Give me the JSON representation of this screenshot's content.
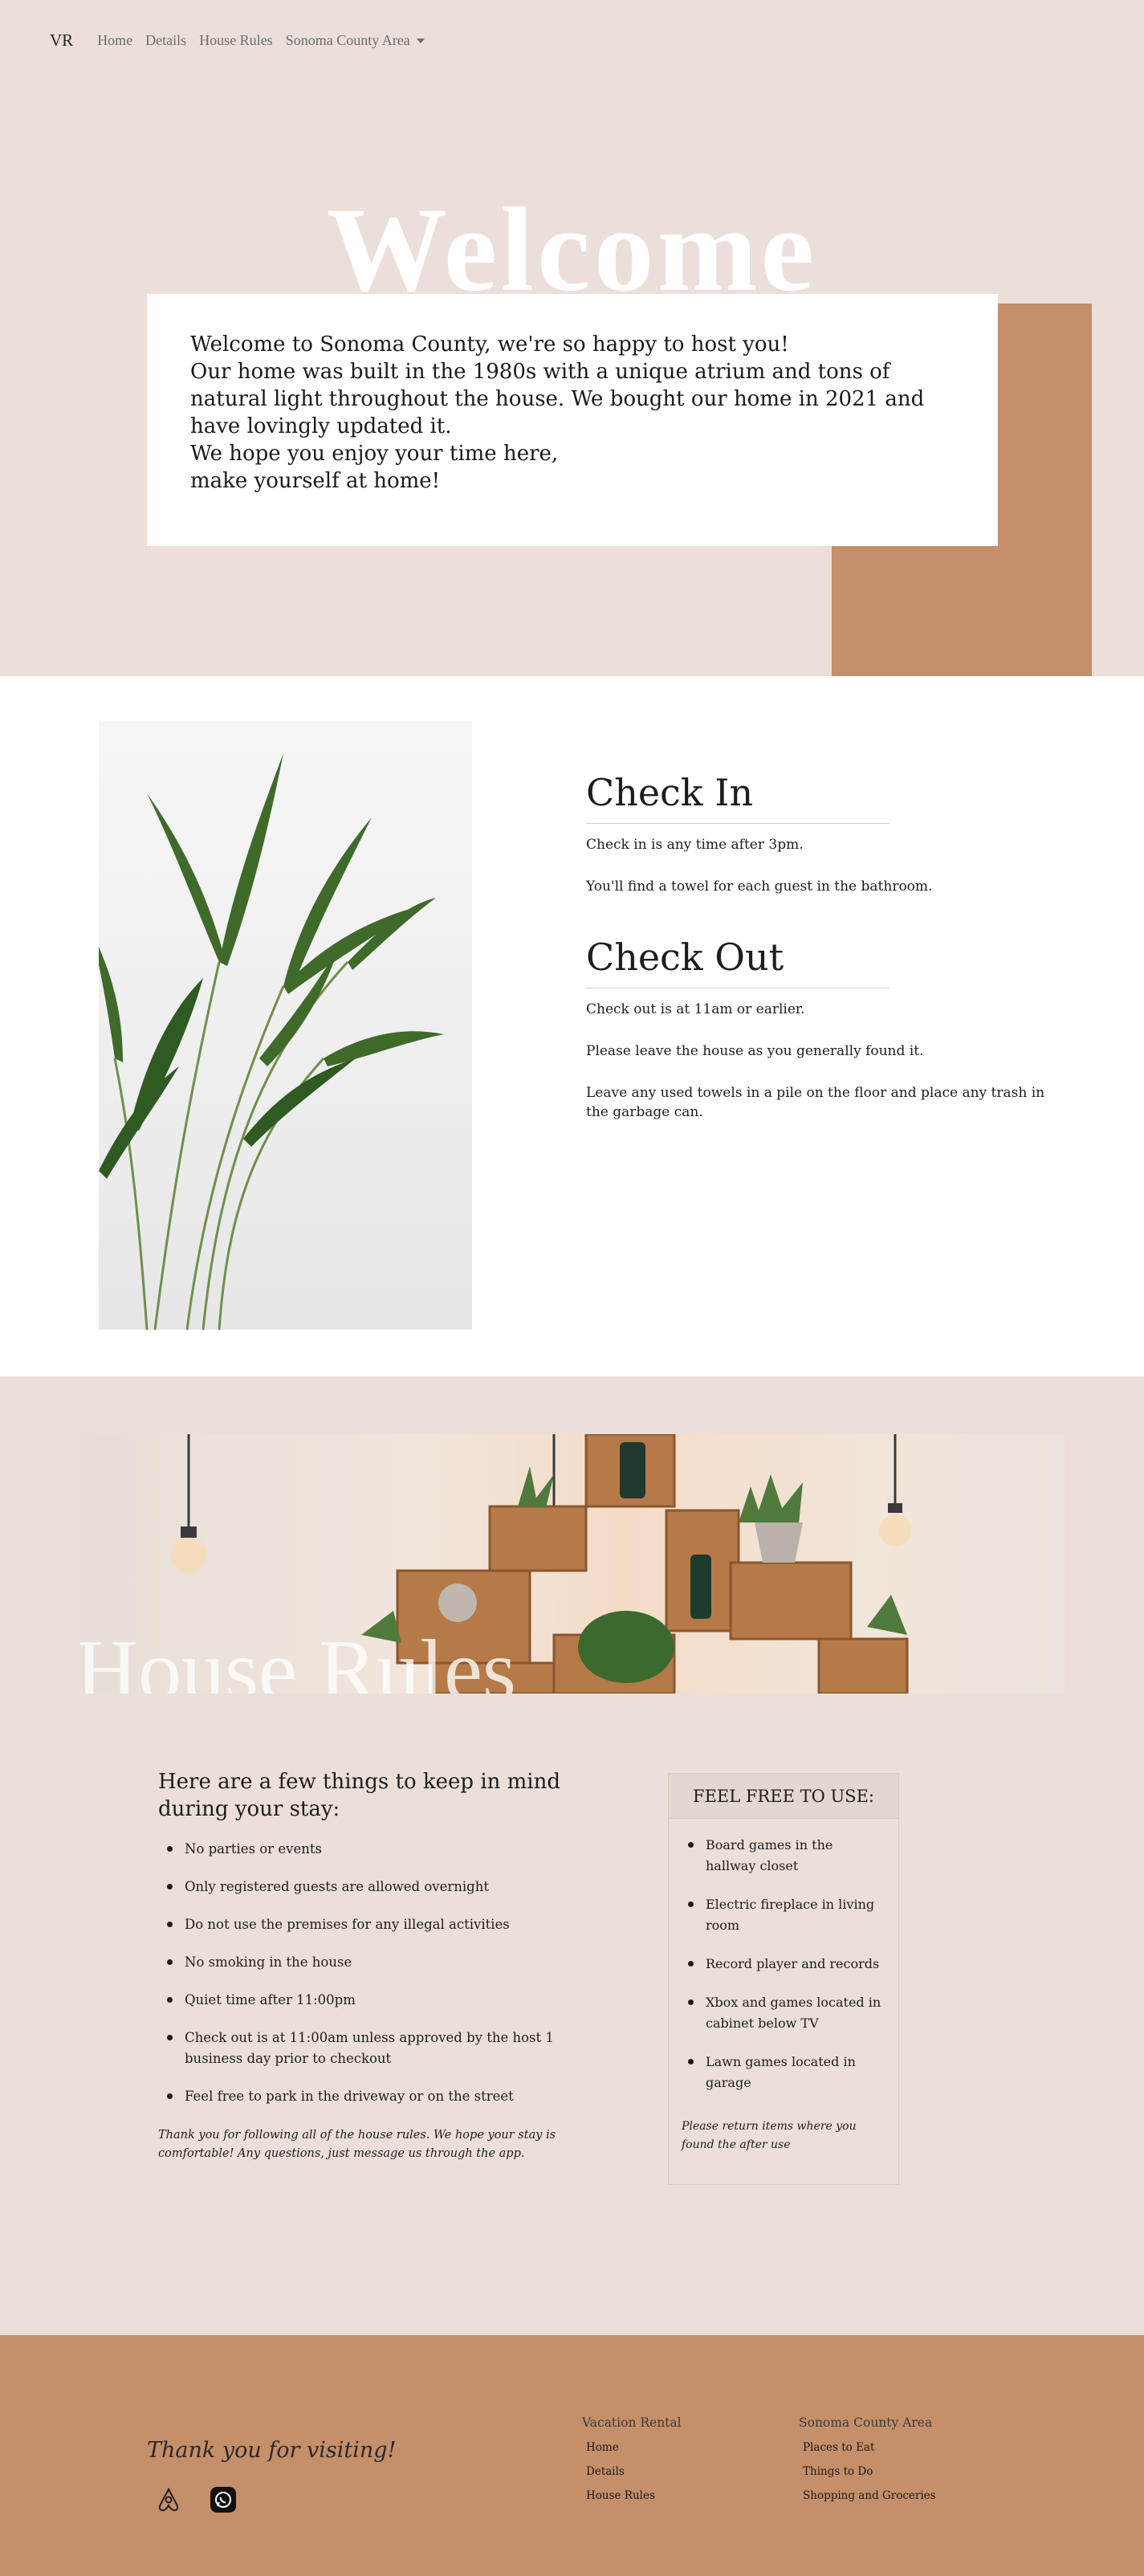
{
  "nav": {
    "brand": "VR",
    "links": [
      "Home",
      "Details",
      "House Rules",
      "Sonoma County Area"
    ]
  },
  "hero": {
    "title": "Welcome",
    "lines": [
      "Welcome to Sonoma County, we're so happy to host you!",
      "Our home was built in the 1980s with a unique atrium and tons of natural light throughout the house. We bought our home in 2021 and have lovingly updated it.",
      "We hope you enjoy your time here,",
      "make yourself at home!"
    ]
  },
  "checkin": {
    "title": "Check In",
    "lines": [
      "Check in is any time after 3pm.",
      "You'll find a towel for each guest in the bathroom."
    ]
  },
  "checkout": {
    "title": "Check Out",
    "lines": [
      "Check out is at 11am or earlier.",
      "Please leave the house as you generally found it.",
      "Leave any used towels in a pile on the floor and place any trash in the garbage can."
    ]
  },
  "rules": {
    "banner_title": "House Rules",
    "heading": "Here are a few things to keep in mind during your stay:",
    "items": [
      "No parties or events",
      "Only registered guests are allowed overnight",
      "Do not use the premises for any illegal activities",
      "No smoking in the house",
      "Quiet time after 11:00pm",
      "Check out is at 11:00am unless approved by the host 1 business day prior to checkout",
      "Feel free to park in the driveway or on the street"
    ],
    "note": "Thank you for following all of the house rules. We hope your stay is comfortable! Any questions, just message us through the app."
  },
  "free_to_use": {
    "title": "FEEL FREE TO USE:",
    "items": [
      "Board games in the hallway closet",
      "Electric fireplace in living room",
      "Record player and records",
      "Xbox and games located in cabinet below TV",
      "Lawn games located in garage"
    ],
    "note": "Please return items where you found the after use"
  },
  "footer": {
    "thanks": "Thank you for visiting!",
    "icons": [
      "airbnb-icon",
      "whatsapp-icon"
    ],
    "col1": {
      "title": "Vacation Rental",
      "links": [
        "Home",
        "Details",
        "House Rules"
      ]
    },
    "col2": {
      "title": "Sonoma County Area",
      "links": [
        "Places to Eat",
        "Things to Do",
        "Shopping and Groceries"
      ]
    }
  },
  "colors": {
    "background": "#ecdfda",
    "accent": "#c58f69",
    "card": "#ffffff",
    "text": "#1d1d1d"
  }
}
